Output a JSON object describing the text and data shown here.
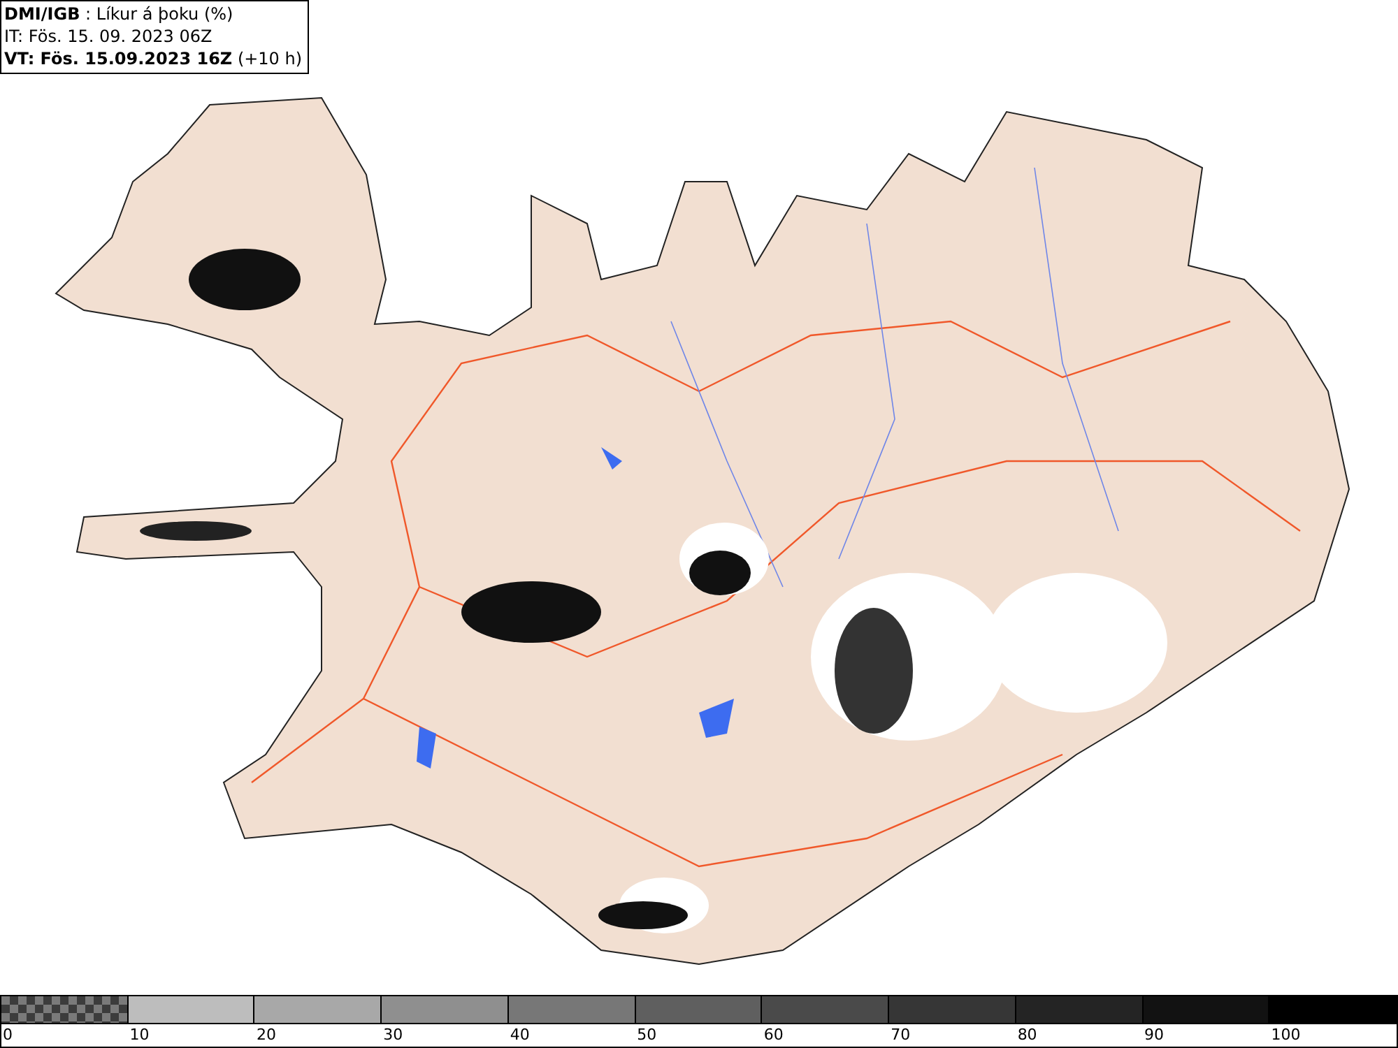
{
  "header": {
    "lines": [
      "**DMI/IGB** : Líkur á þoku (%)",
      "IT: Fös. 15. 09. 2023 06Z",
      "**VT: Fös. 15.09.2023 16Z** (+10 h)"
    ]
  },
  "legend": {
    "bins": [
      {
        "label": "0",
        "color": "#7a7a7a",
        "kind": "checker"
      },
      {
        "label": "10",
        "color": "#bdbdbd",
        "kind": "solid"
      },
      {
        "label": "20",
        "color": "#a8a8a8",
        "kind": "solid"
      },
      {
        "label": "30",
        "color": "#8f8f8f",
        "kind": "solid"
      },
      {
        "label": "40",
        "color": "#777777",
        "kind": "solid"
      },
      {
        "label": "50",
        "color": "#5f5f5f",
        "kind": "solid"
      },
      {
        "label": "60",
        "color": "#4a4a4a",
        "kind": "solid"
      },
      {
        "label": "70",
        "color": "#363636",
        "kind": "solid"
      },
      {
        "label": "80",
        "color": "#242424",
        "kind": "solid"
      },
      {
        "label": "90",
        "color": "#121212",
        "kind": "solid"
      },
      {
        "label": "100",
        "color": "#000000",
        "kind": "solid"
      }
    ]
  }
}
